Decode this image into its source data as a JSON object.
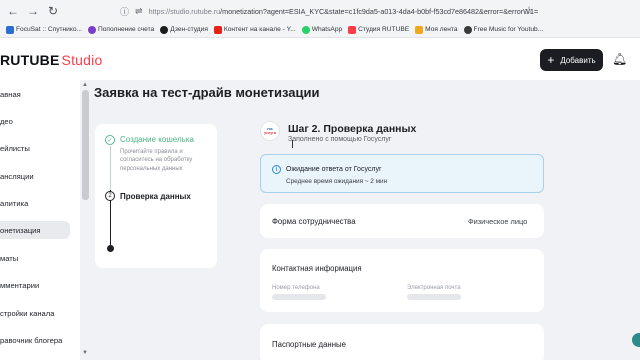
{
  "browser": {
    "url_host": "https://studio.rutube.ru",
    "url_rest": "/monetization?agent=ESIA_KYC&state=c1fc9da5-a013-4da4-b0bf-f53cd7e86482&error=&errorW1=",
    "bookmarks": [
      {
        "label": "FocuSat :: Спутнико...",
        "color": "#2a6fd1"
      },
      {
        "label": "Пополнение счета",
        "color": "#7a3ec7"
      },
      {
        "label": "Дзен-студия",
        "color": "#1b1b1b"
      },
      {
        "label": "Контент на канале - Y...",
        "color": "#e62117"
      },
      {
        "label": "WhatsApp",
        "color": "#25d366"
      },
      {
        "label": "Студия RUTUBE",
        "color": "#ff3b48"
      },
      {
        "label": "Моя лента",
        "color": "#f0a81c"
      },
      {
        "label": "Free Music for Youtub...",
        "color": "#3a3a3a"
      }
    ]
  },
  "header": {
    "logo_main": "RUTUBE",
    "logo_sub": "Studio",
    "add_button_label": "Добавить",
    "bell_icon": "bell-icon"
  },
  "sidebar": {
    "items": [
      {
        "label": "авная",
        "active": false
      },
      {
        "label": "део",
        "active": false
      },
      {
        "label": "ейлисты",
        "active": false
      },
      {
        "label": "ансляции",
        "active": false
      },
      {
        "label": "алитика",
        "active": false
      },
      {
        "label": "онетизация",
        "active": true
      },
      {
        "label": "маты",
        "active": false
      },
      {
        "label": "мментарии",
        "active": false
      },
      {
        "label": "стройки канала",
        "active": false
      },
      {
        "label": "равочник блогера",
        "active": false
      }
    ]
  },
  "main": {
    "page_title": "Заявка на тест-драйв монетизации",
    "steps": {
      "step1_title": "Создание кошелька",
      "step1_desc": "Прочитайте правила и согласитесь на обработку персональных данных",
      "step2_number": "2",
      "step2_title": "Проверка данных"
    },
    "step_header": {
      "logo_line1": "гос",
      "logo_line2": "услуги",
      "title": "Шаг 2. Проверка данных",
      "subtitle": "Заполнено с помощью Госуслуг"
    },
    "info": {
      "title": "Ожидание ответа от Госуслуг",
      "subtitle": "Среднее время ожидания ~ 2 мин"
    },
    "form_card": {
      "label": "Форма сотрудничества",
      "value": "Физическое лицо"
    },
    "contact_card": {
      "label": "Контактная информация",
      "phone_label": "Номер телефона",
      "email_label": "Электронная почта"
    },
    "passport_card": {
      "label": "Паспортные данные"
    }
  },
  "colors": {
    "accent_red": "#ff3b48",
    "step_done_green": "#4cb580",
    "info_blue": "#2b8fd6"
  }
}
